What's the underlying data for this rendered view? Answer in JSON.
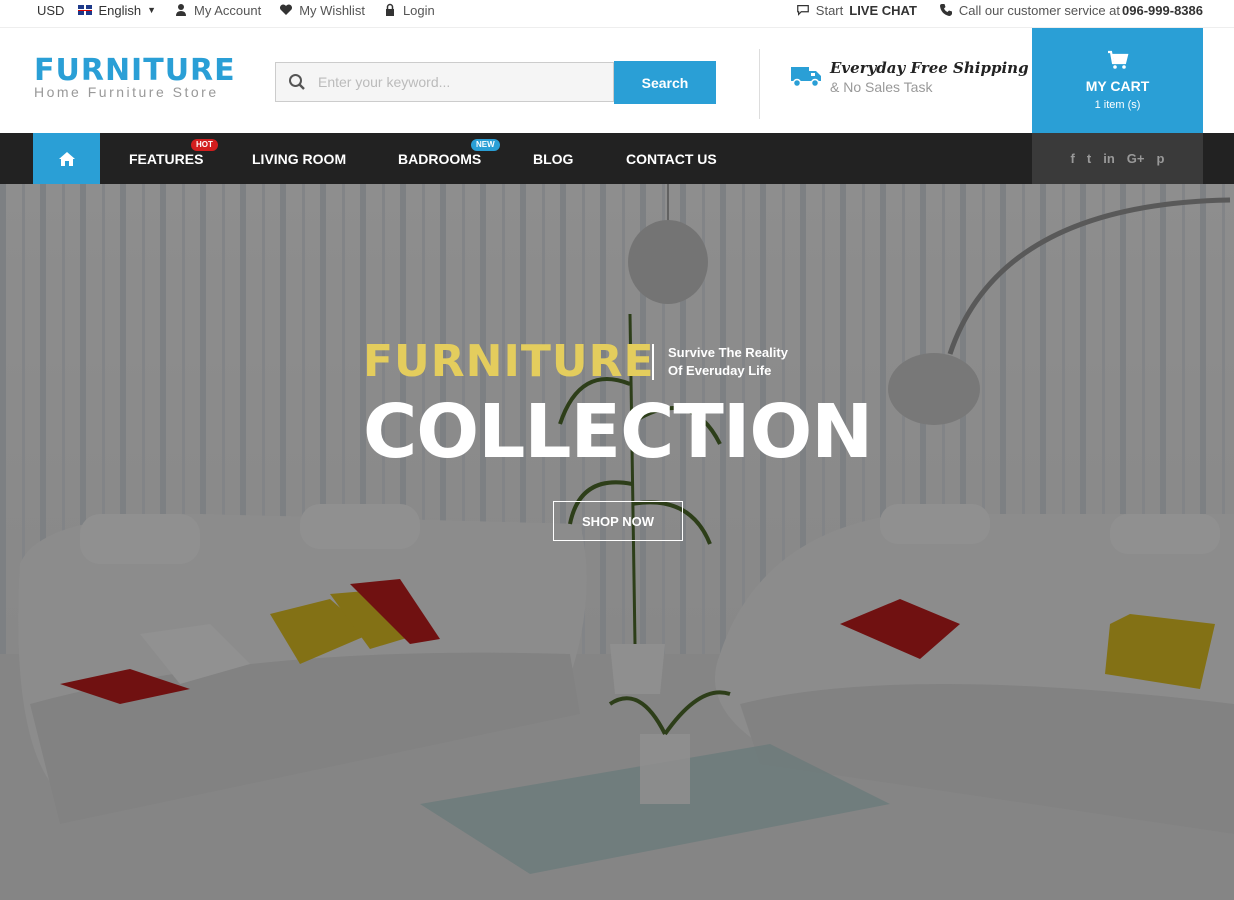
{
  "topbar": {
    "currency": "USD",
    "language": "English",
    "my_account": "My Account",
    "wishlist": "My Wishlist",
    "login": "Login",
    "live_chat_prefix": "Start",
    "live_chat": "LIVE CHAT",
    "phone_prefix": "Call our customer service at",
    "phone": "096-999-8386"
  },
  "header": {
    "logo_name": "FURNITURE",
    "logo_tagline": "Home Furniture Store",
    "search_placeholder": "Enter your keyword...",
    "search_button": "Search",
    "shipping_title": "Everyday Free Shipping",
    "shipping_sub": "& No Sales Task",
    "cart_title": "MY CART",
    "cart_count": "1 item (s)"
  },
  "nav": {
    "items": [
      {
        "label": "FEATURES",
        "badge": "HOT"
      },
      {
        "label": "LIVING ROOM"
      },
      {
        "label": "BADROOMS",
        "badge": "NEW"
      },
      {
        "label": "BLOG"
      },
      {
        "label": "CONTACT US"
      }
    ],
    "social": [
      "f",
      "t",
      "in",
      "G+",
      "p"
    ]
  },
  "hero": {
    "title_small": "FURNITURE",
    "tagline_line1": "Survive The Reality",
    "tagline_line2": "Of Everuday Life",
    "title_big": "COLLECTION",
    "cta": "SHOP NOW"
  },
  "colors": {
    "accent": "#2a9fd6",
    "nav_bg": "#222222",
    "hero_gold": "#e4cd5d",
    "hot_badge": "#d31e1e"
  }
}
